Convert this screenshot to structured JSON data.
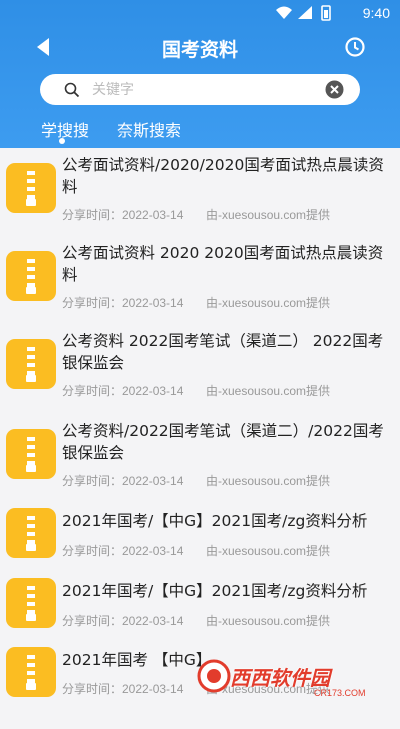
{
  "status_bar": {
    "time": "9:40"
  },
  "header": {
    "title": "国考资料"
  },
  "search": {
    "placeholder": "关键字"
  },
  "tabs": [
    {
      "label": "学搜搜",
      "active": true
    },
    {
      "label": "奈斯搜索",
      "active": false
    }
  ],
  "results": [
    {
      "title": "公考面试资料/2020/2020国考面试热点晨读资料",
      "time": "分享时间：2022-03-14",
      "source": "由-xuesousou.com提供"
    },
    {
      "title": "公考面试资料 2020 2020国考面试热点晨读资料",
      "time": "分享时间：2022-03-14",
      "source": "由-xuesousou.com提供"
    },
    {
      "title": "公考资料 2022国考笔试（渠道二） 2022国考银保监会",
      "time": "分享时间：2022-03-14",
      "source": "由-xuesousou.com提供"
    },
    {
      "title": "公考资料/2022国考笔试（渠道二）/2022国考银保监会",
      "time": "分享时间：2022-03-14",
      "source": "由-xuesousou.com提供"
    },
    {
      "title": "2021年国考/【中G】2021国考/zg资料分析",
      "time": "分享时间：2022-03-14",
      "source": "由-xuesousou.com提供"
    },
    {
      "title": "2021年国考/【中G】2021国考/zg资料分析",
      "time": "分享时间：2022-03-14",
      "source": "由-xuesousou.com提供"
    },
    {
      "title": "2021年国考 【中G】",
      "time": "分享时间：2022-03-14",
      "source": "由-xuesousou.com提供"
    }
  ],
  "watermark": {
    "text": "西西软件园",
    "sub": "CR173.COM"
  },
  "colors": {
    "header_blue": "#3d9cf0",
    "zip_icon": "#fbbd22",
    "text": "#222222",
    "meta": "#999999"
  },
  "icons": {
    "back": "back-arrow-icon",
    "history": "clock-icon",
    "search": "search-icon",
    "clear": "clear-icon",
    "file": "zip-file-icon"
  }
}
